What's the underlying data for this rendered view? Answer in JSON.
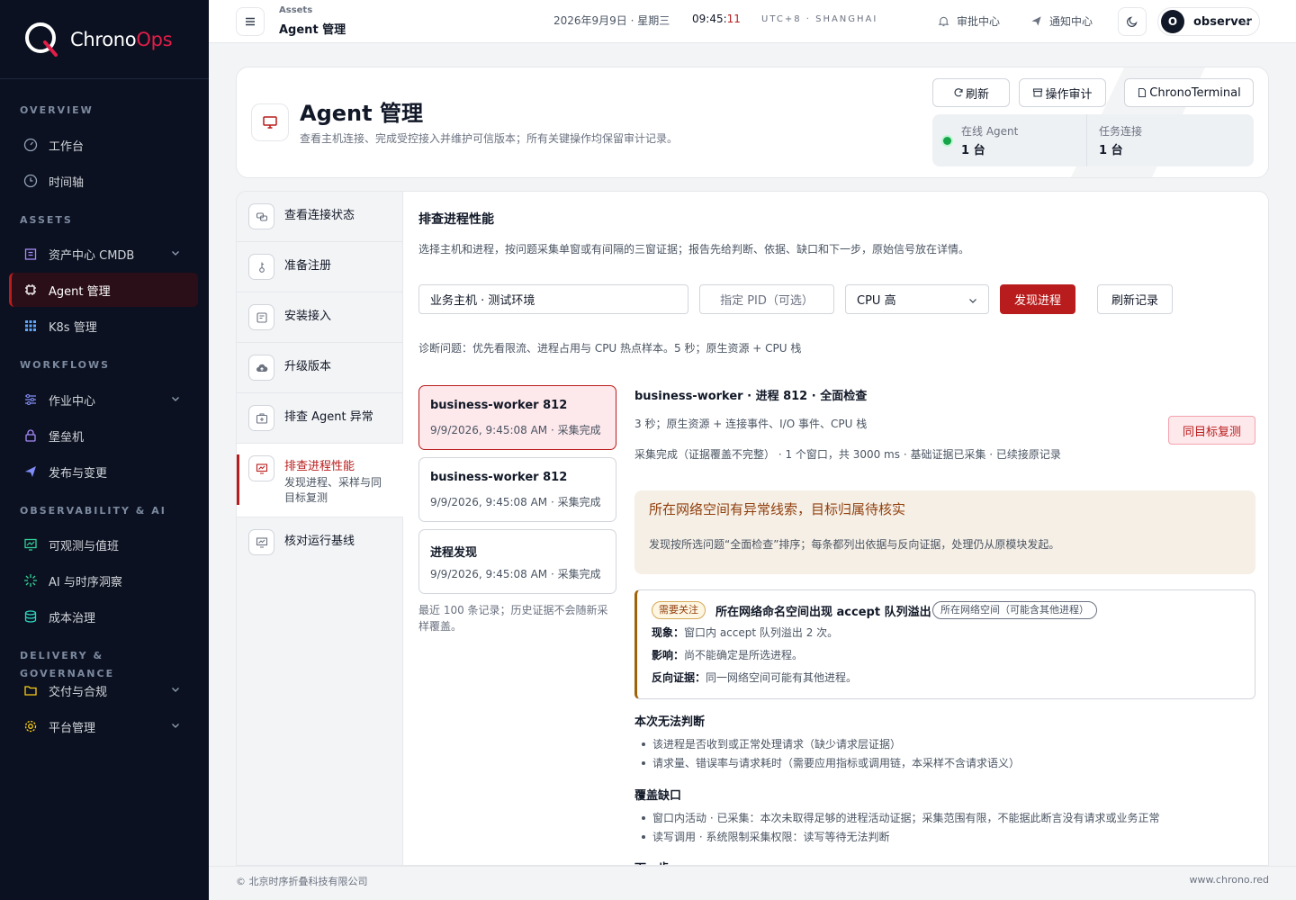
{
  "brand": {
    "name_a": "Chrono",
    "name_b": "Ops"
  },
  "sidebar": {
    "sections": [
      {
        "label": "OVERVIEW"
      },
      {
        "label": "ASSETS"
      },
      {
        "label": "WORKFLOWS"
      },
      {
        "label": "OBSERVABILITY & AI"
      },
      {
        "label": "DELIVERY & GOVERNANCE"
      }
    ],
    "items": [
      {
        "label": "工作台",
        "icon": "gauge-icon"
      },
      {
        "label": "时间轴",
        "icon": "clock-icon"
      },
      {
        "label": "资产中心 CMDB",
        "icon": "building-icon",
        "expandable": true
      },
      {
        "label": "Agent 管理",
        "icon": "chip-icon",
        "active": true
      },
      {
        "label": "K8s 管理",
        "icon": "grid-icon"
      },
      {
        "label": "作业中心",
        "icon": "sliders-icon",
        "expandable": true
      },
      {
        "label": "堡垒机",
        "icon": "lock-icon"
      },
      {
        "label": "发布与变更",
        "icon": "send-icon"
      },
      {
        "label": "可观测与值班",
        "icon": "monitor-chart-icon"
      },
      {
        "label": "AI 与时序洞察",
        "icon": "sparkle-icon"
      },
      {
        "label": "成本治理",
        "icon": "database-icon"
      },
      {
        "label": "交付与合规",
        "icon": "folder-icon",
        "expandable": true
      },
      {
        "label": "平台管理",
        "icon": "gear-icon",
        "expandable": true
      }
    ],
    "accent": "#b91c1c"
  },
  "topbar": {
    "breadcrumb_parent": "Assets",
    "breadcrumb_current": "Agent 管理",
    "date": "2026年9月9日 · 星期三",
    "time_hm": "09:45:",
    "time_s": "11",
    "timezone": "UTC+8 · SHANGHAI",
    "approval_label": "审批中心",
    "notify_label": "通知中心",
    "user_initial": "O",
    "user_name": "observer"
  },
  "header": {
    "title": "Agent 管理",
    "subtitle": "查看主机连接、完成受控接入并维护可信版本；所有关键操作均保留审计记录。",
    "buttons": {
      "refresh": "刷新",
      "audit": "操作审计",
      "terminal": "ChronoTerminal"
    },
    "stats": [
      {
        "label": "在线 Agent",
        "value": "1 台"
      },
      {
        "label": "任务连接",
        "value": "1 台"
      }
    ]
  },
  "steps": [
    {
      "title": "查看连接状态",
      "icon": "link-icon"
    },
    {
      "title": "准备注册",
      "icon": "key-icon"
    },
    {
      "title": "安装接入",
      "icon": "install-icon"
    },
    {
      "title": "升级版本",
      "icon": "cloud-upload-icon"
    },
    {
      "title": "排查 Agent 异常",
      "icon": "medkit-icon"
    },
    {
      "title": "排查进程性能",
      "desc": "发现进程、采样与同目标复测",
      "icon": "monitor-chart-icon",
      "active": true
    },
    {
      "title": "核对运行基线",
      "icon": "monitor-chart-icon"
    }
  ],
  "main": {
    "title": "排查进程性能",
    "subtitle": "选择主机和进程，按问题采集单窗或有间隔的三窗证据；报告先给判断、依据、缺口和下一步，原始信号放在详情。",
    "host_value": "业务主机 · 测试环境",
    "pid_placeholder": "指定 PID（可选）",
    "problem_value": "CPU 高",
    "discover_label": "发现进程",
    "refresh_records_label": "刷新记录",
    "diagnosis": "诊断问题：优先看限流、进程占用与 CPU 热点样本。5 秒；原生资源 + CPU 栈",
    "records": [
      {
        "name": "business-worker 812",
        "meta": "9/9/2026, 9:45:08 AM · 采集完成"
      },
      {
        "name": "business-worker 812",
        "meta": "9/9/2026, 9:45:08 AM · 采集完成"
      },
      {
        "name": "进程发现",
        "meta": "9/9/2026, 9:45:08 AM · 采集完成"
      }
    ],
    "records_note": "最近 100 条记录；历史证据不会随新采样覆盖。"
  },
  "detail": {
    "title": "business-worker · 进程 812 · 全面检查",
    "line1": "3 秒；原生资源 + 连接事件、I/O 事件、CPU 栈",
    "line2": "采集完成（证据覆盖不完整） · 1 个窗口，共 3000 ms · 基础证据已采集 · 已续接原记录",
    "rerun_label": "同目标复测",
    "alert_title": "所在网络空间有异常线索，目标归属待核实",
    "alert_body": "发现按所选问题“全面检查”排序；每条都列出依据与反向证据，处理仍从原模块发起。",
    "finding": {
      "severity": "需要关注",
      "title": "所在网络命名空间出现 accept 队列溢出",
      "scope": "所在网络空间（可能含其他进程）",
      "rows": [
        {
          "label": "现象：",
          "text": "窗口内 accept 队列溢出 2 次。"
        },
        {
          "label": "影响：",
          "text": "尚不能确定是所选进程。"
        },
        {
          "label": "反向证据：",
          "text": "同一网络空间可能有其他进程。"
        }
      ]
    },
    "cannot_judge_title": "本次无法判断",
    "cannot_judge": [
      "该进程是否收到或正常处理请求（缺少请求层证据）",
      "请求量、错误率与请求耗时（需要应用指标或调用链，本采样不含请求语义）"
    ],
    "gaps_title": "覆盖缺口",
    "gaps": [
      "窗口内活动 · 已采集：本次未取得足够的进程活动证据；采集范围有限，不能据此断言没有请求或业务正常",
      "读写调用 · 系统限制采集权限：读写等待无法判断"
    ],
    "next_title": "下一步"
  },
  "footer": {
    "company": "© 北京时序折叠科技有限公司",
    "site": "www.chrono.red"
  }
}
